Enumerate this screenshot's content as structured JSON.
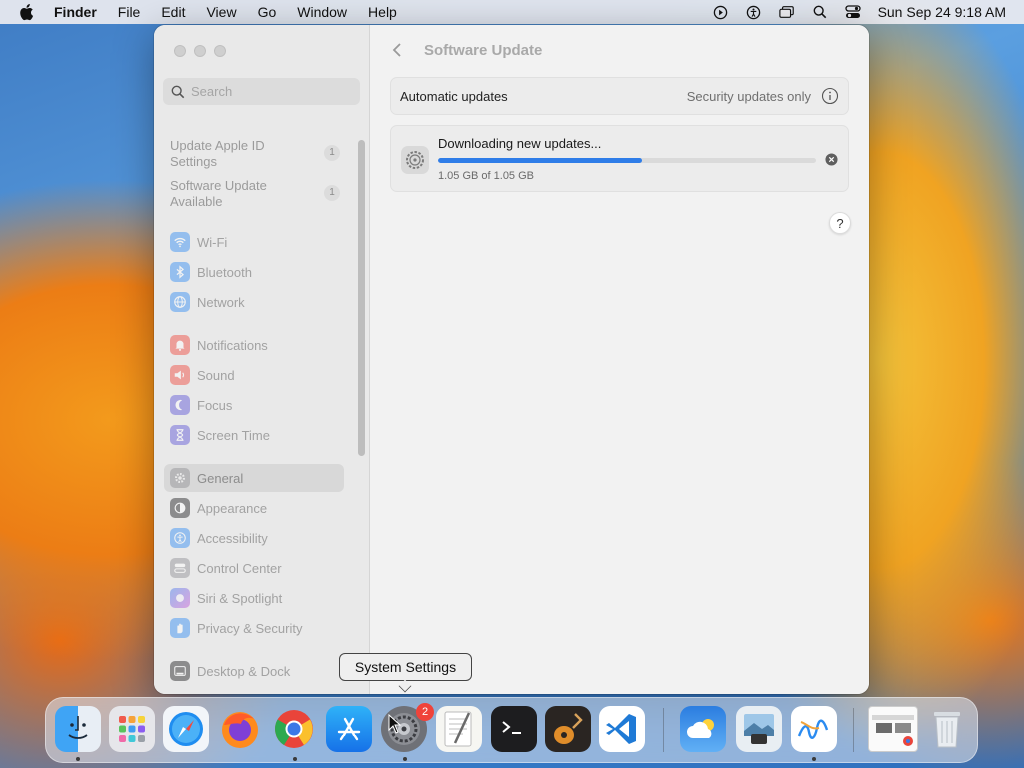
{
  "menubar": {
    "app_name": "Finder",
    "menus": [
      "File",
      "Edit",
      "View",
      "Go",
      "Window",
      "Help"
    ],
    "clock": "Sun Sep 24  9:18 AM",
    "status_icons": [
      "play-circle-icon",
      "accessibility-icon",
      "screen-mirroring-icon",
      "search-icon",
      "control-center-icon"
    ]
  },
  "sidebar": {
    "search_placeholder": "Search",
    "alerts": [
      {
        "label": "Update Apple ID Settings",
        "badge": "1"
      },
      {
        "label": "Software Update Available",
        "badge": "1"
      }
    ],
    "items": [
      {
        "label": "Wi-Fi",
        "icon": "wifi-icon",
        "color": "#2e8cf5"
      },
      {
        "label": "Bluetooth",
        "icon": "bluetooth-icon",
        "color": "#2e8cf5"
      },
      {
        "label": "Network",
        "icon": "globe-icon",
        "color": "#2e8cf5"
      },
      {
        "label": "Notifications",
        "icon": "bell-icon",
        "color": "#f0453a"
      },
      {
        "label": "Sound",
        "icon": "speaker-icon",
        "color": "#f0453a"
      },
      {
        "label": "Focus",
        "icon": "moon-icon",
        "color": "#5b52d6"
      },
      {
        "label": "Screen Time",
        "icon": "hourglass-icon",
        "color": "#5b52d6"
      },
      {
        "label": "General",
        "icon": "gear-icon",
        "color": "#8e8e93"
      },
      {
        "label": "Appearance",
        "icon": "appearance-icon",
        "color": "#1c1c1e"
      },
      {
        "label": "Accessibility",
        "icon": "accessibility-icon",
        "color": "#2e8cf5"
      },
      {
        "label": "Control Center",
        "icon": "control-center-icon",
        "color": "#8e8e93"
      },
      {
        "label": "Siri & Spotlight",
        "icon": "siri-icon",
        "color": "#b04fd6"
      },
      {
        "label": "Privacy & Security",
        "icon": "hand-icon",
        "color": "#2e8cf5"
      },
      {
        "label": "Desktop & Dock",
        "icon": "dock-icon",
        "color": "#1c1c1e"
      }
    ],
    "selected": "General"
  },
  "main": {
    "title": "Software Update",
    "auto_updates_label": "Automatic updates",
    "auto_updates_value": "Security updates only",
    "download_title": "Downloading new updates...",
    "download_size": "1.05 GB of 1.05 GB",
    "download_progress": 0.54,
    "help_label": "?"
  },
  "tooltip": "System Settings",
  "dock": {
    "apps": [
      {
        "name": "Finder",
        "icon": "finder-icon",
        "running": true
      },
      {
        "name": "Launchpad",
        "icon": "launchpad-icon",
        "running": false
      },
      {
        "name": "Safari",
        "icon": "safari-icon",
        "running": false
      },
      {
        "name": "Firefox",
        "icon": "firefox-icon",
        "running": false
      },
      {
        "name": "Google Chrome",
        "icon": "chrome-icon",
        "running": true
      },
      {
        "name": "App Store",
        "icon": "app-store-icon",
        "running": false
      },
      {
        "name": "System Settings",
        "icon": "system-settings-icon",
        "running": true,
        "badge": "2"
      },
      {
        "name": "TextEdit",
        "icon": "textedit-icon",
        "running": false
      },
      {
        "name": "Terminal",
        "icon": "terminal-icon",
        "running": false
      },
      {
        "name": "GarageBand",
        "icon": "garageband-icon",
        "running": false
      },
      {
        "name": "Visual Studio Code",
        "icon": "vscode-icon",
        "running": false
      },
      {
        "name": "Weather",
        "icon": "weather-icon",
        "running": false
      },
      {
        "name": "Preview",
        "icon": "preview-icon",
        "running": false
      },
      {
        "name": "Freeform",
        "icon": "freeform-icon",
        "running": true
      },
      {
        "name": "Chrome Window",
        "icon": "window-thumbnail-icon",
        "running": false
      },
      {
        "name": "Trash",
        "icon": "trash-icon",
        "running": false
      }
    ]
  }
}
